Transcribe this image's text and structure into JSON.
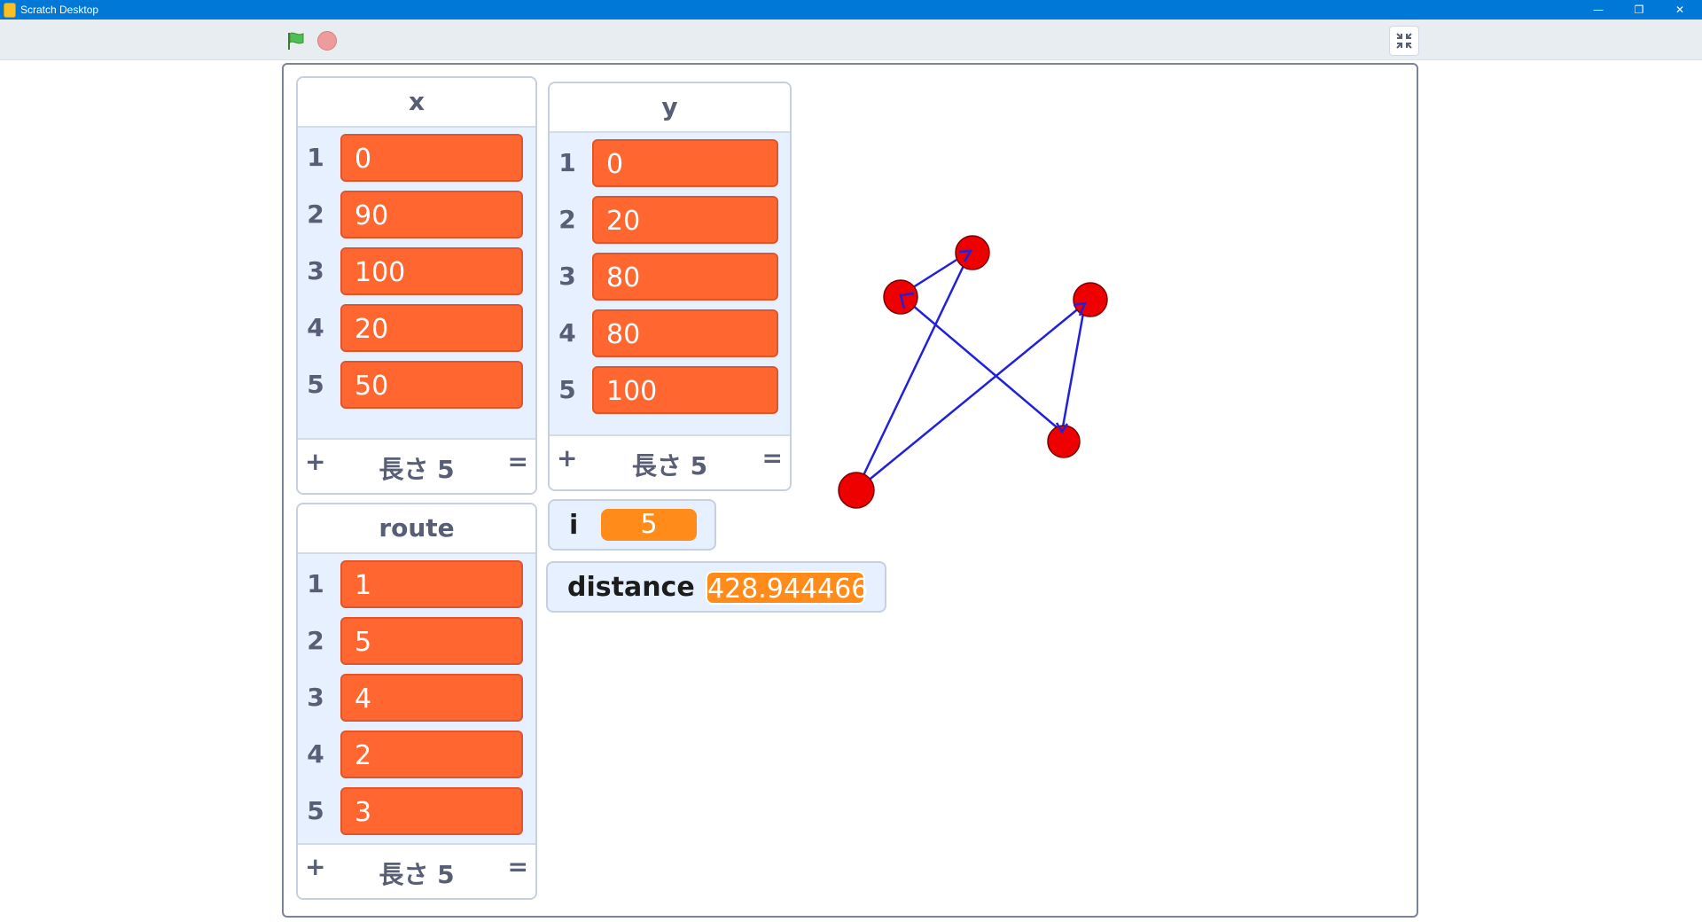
{
  "window": {
    "title": "Scratch Desktop",
    "minimize_icon": "minimize-icon",
    "restore_icon": "restore-icon",
    "close_icon": "close-icon"
  },
  "controls": {
    "green_flag_icon": "green-flag-icon",
    "stop_icon": "stop-sign-icon",
    "fullscreen_icon": "exit-fullscreen-icon"
  },
  "lists": {
    "x": {
      "name": "x",
      "indices": [
        "1",
        "2",
        "3",
        "4",
        "5"
      ],
      "items": [
        "0",
        "90",
        "100",
        "20",
        "50"
      ],
      "footer": {
        "add": "+",
        "length": "長さ 5",
        "resize": "="
      }
    },
    "y": {
      "name": "y",
      "indices": [
        "1",
        "2",
        "3",
        "4",
        "5"
      ],
      "items": [
        "0",
        "20",
        "80",
        "80",
        "100"
      ],
      "footer": {
        "add": "+",
        "length": "長さ 5",
        "resize": "="
      }
    },
    "route": {
      "name": "route",
      "indices": [
        "1",
        "2",
        "3",
        "4",
        "5"
      ],
      "items": [
        "1",
        "5",
        "4",
        "2",
        "3"
      ],
      "footer": {
        "add": "+",
        "length": "長さ 5",
        "resize": "="
      }
    }
  },
  "variables": {
    "i": {
      "label": "i",
      "value": "5"
    },
    "distance": {
      "label": "distance",
      "value": "428.944466"
    }
  },
  "stage_drawing": {
    "point_color": "#ff0000",
    "line_color": "#2020e0",
    "route_order": [
      1,
      5,
      4,
      2,
      3
    ]
  },
  "colors": {
    "titlebar": "#0078d7",
    "list_item": "#ff6630",
    "variable_value": "#ff8c1a",
    "monitor_bg": "#e6f0ff"
  }
}
